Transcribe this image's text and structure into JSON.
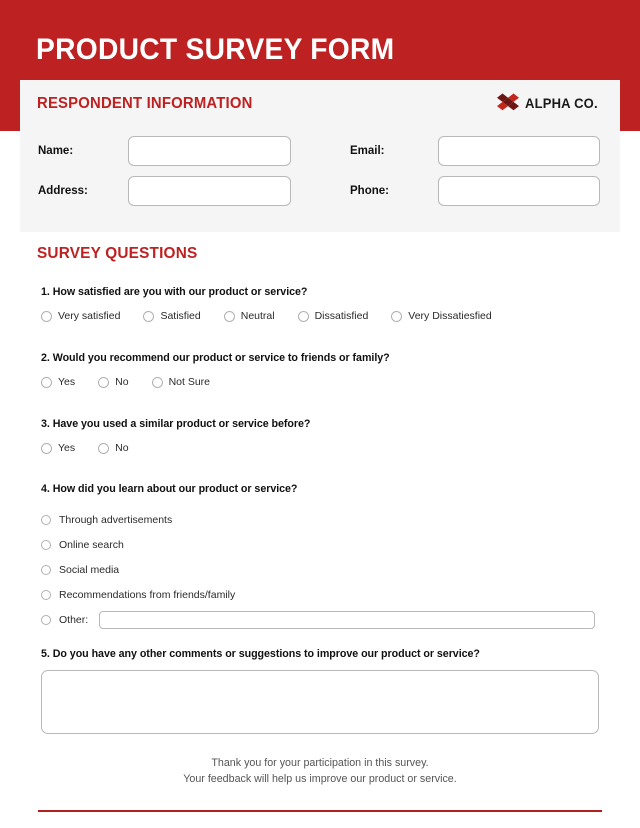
{
  "colors": {
    "brand_red": "#be2121",
    "panel_gray": "#f5f5f5",
    "rule_red": "#b02020",
    "logo_red": "#c0281f",
    "logo_dark": "#6e1512"
  },
  "header": {
    "title": "PRODUCT SURVEY FORM"
  },
  "respondent": {
    "heading": "RESPONDENT INFORMATION",
    "logo_text": "ALPHA CO.",
    "fields": [
      {
        "label": "Name:",
        "value": "",
        "placeholder": ""
      },
      {
        "label": "Address:",
        "value": "",
        "placeholder": ""
      },
      {
        "label": "Email:",
        "value": "",
        "placeholder": ""
      },
      {
        "label": "Phone:",
        "value": "",
        "placeholder": ""
      }
    ]
  },
  "survey": {
    "heading": "SURVEY QUESTIONS",
    "questions": [
      {
        "text": "1. How satisfied are you with our product or service?",
        "options": [
          {
            "label": "Very satisfied"
          },
          {
            "label": "Satisfied"
          },
          {
            "label": "Neutral"
          },
          {
            "label": "Dissatisfied"
          },
          {
            "label": "Very Dissatiesfied"
          }
        ]
      },
      {
        "text": "2. Would you recommend our product or service to friends or family?",
        "options": [
          {
            "label": "Yes"
          },
          {
            "label": "No"
          },
          {
            "label": "Not Sure"
          }
        ]
      },
      {
        "text": "3. Have you used a similar product or service before?",
        "options": [
          {
            "label": "Yes"
          },
          {
            "label": "No"
          }
        ]
      },
      {
        "text": "4. How did you learn about our product or service?",
        "options": [
          {
            "label": "Through advertisements"
          },
          {
            "label": "Online search"
          },
          {
            "label": "Social media"
          },
          {
            "label": "Recommendations from friends/family"
          },
          {
            "label": "Other:",
            "other_value": "",
            "other_placeholder": ""
          }
        ]
      },
      {
        "text": "5. Do you have any other comments or suggestions to improve our product or service?",
        "answer_value": "",
        "answer_placeholder": ""
      }
    ]
  },
  "footer": {
    "line1": "Thank you for your participation in this survey.",
    "line2": "Your feedback will help us improve our product or service."
  }
}
